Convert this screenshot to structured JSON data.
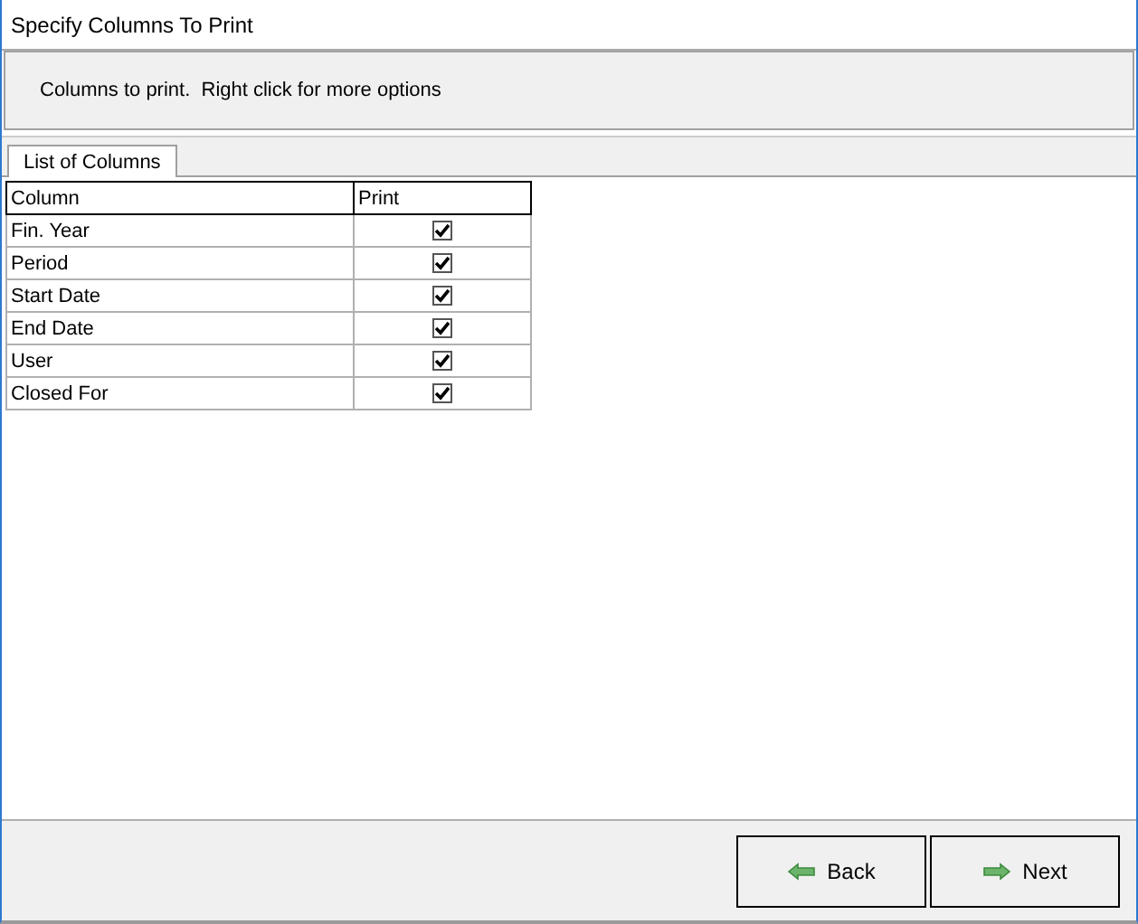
{
  "window": {
    "title": "Specify Columns To Print"
  },
  "header": {
    "text": "Columns to print.  Right click for more options"
  },
  "tabs": [
    {
      "label": "List of Columns",
      "selected": true
    }
  ],
  "table": {
    "columns": [
      "Column",
      "Print"
    ],
    "rows": [
      {
        "name": "Fin. Year",
        "checked": true
      },
      {
        "name": "Period",
        "checked": true
      },
      {
        "name": "Start Date",
        "checked": true
      },
      {
        "name": "End Date",
        "checked": true
      },
      {
        "name": "User",
        "checked": true
      },
      {
        "name": "Closed For",
        "checked": true
      }
    ]
  },
  "buttons": [
    {
      "label": "Back",
      "kind": "back"
    },
    {
      "label": "Next",
      "kind": "next"
    }
  ]
}
